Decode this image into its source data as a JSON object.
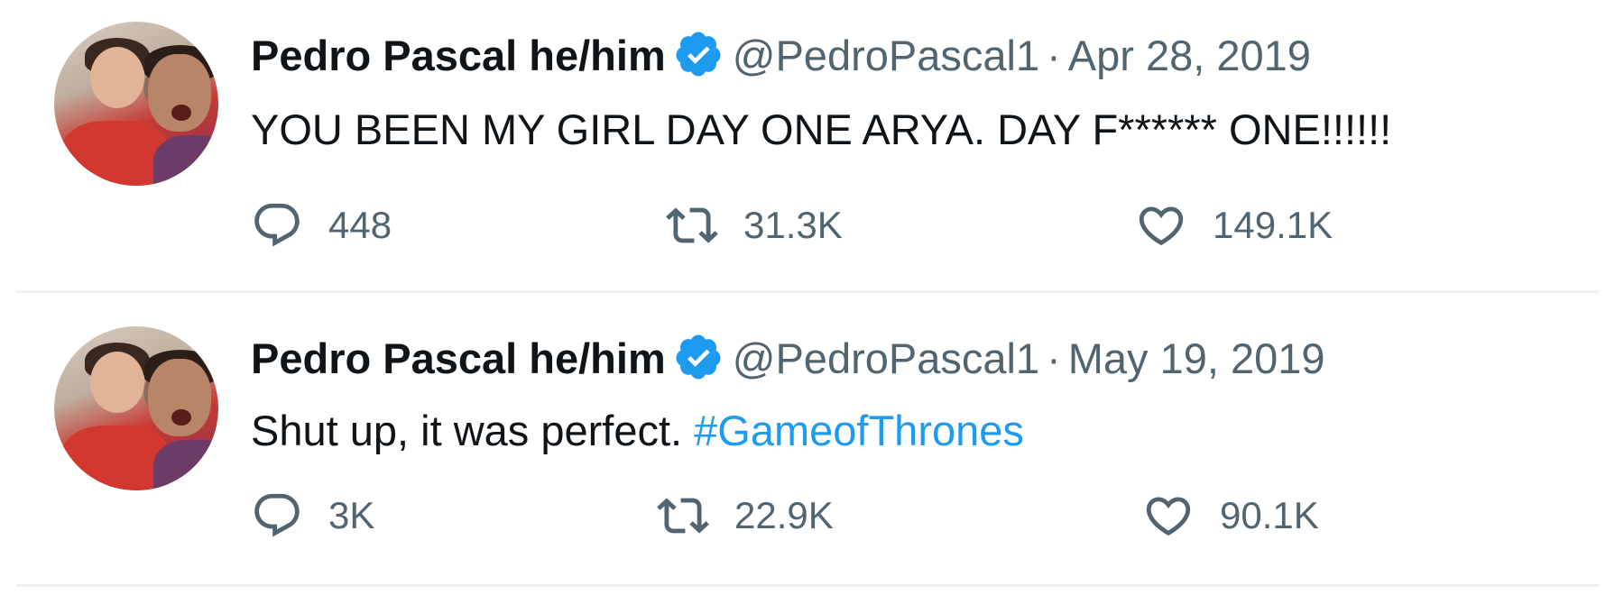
{
  "colors": {
    "text": "#0f1419",
    "secondary": "#536471",
    "accent_blue": "#1d9bf0",
    "divider": "#eef0f2"
  },
  "tweets": [
    {
      "name": "Pedro Pascal he/him",
      "handle": "@PedroPascal1",
      "separator": "·",
      "date": "Apr 28, 2019",
      "text": "YOU BEEN MY GIRL DAY ONE ARYA. DAY F****** ONE!!!!!!",
      "hashtag": "",
      "replies": "448",
      "retweets": "31.3K",
      "likes": "149.1K",
      "icons": [
        "verified-badge-icon",
        "reply-icon",
        "retweet-icon",
        "like-icon"
      ]
    },
    {
      "name": "Pedro Pascal he/him",
      "handle": "@PedroPascal1",
      "separator": "·",
      "date": "May 19, 2019",
      "text": "Shut up, it was perfect. ",
      "hashtag": "#GameofThrones",
      "replies": "3K",
      "retweets": "22.9K",
      "likes": "90.1K",
      "icons": [
        "verified-badge-icon",
        "reply-icon",
        "retweet-icon",
        "like-icon"
      ]
    }
  ]
}
